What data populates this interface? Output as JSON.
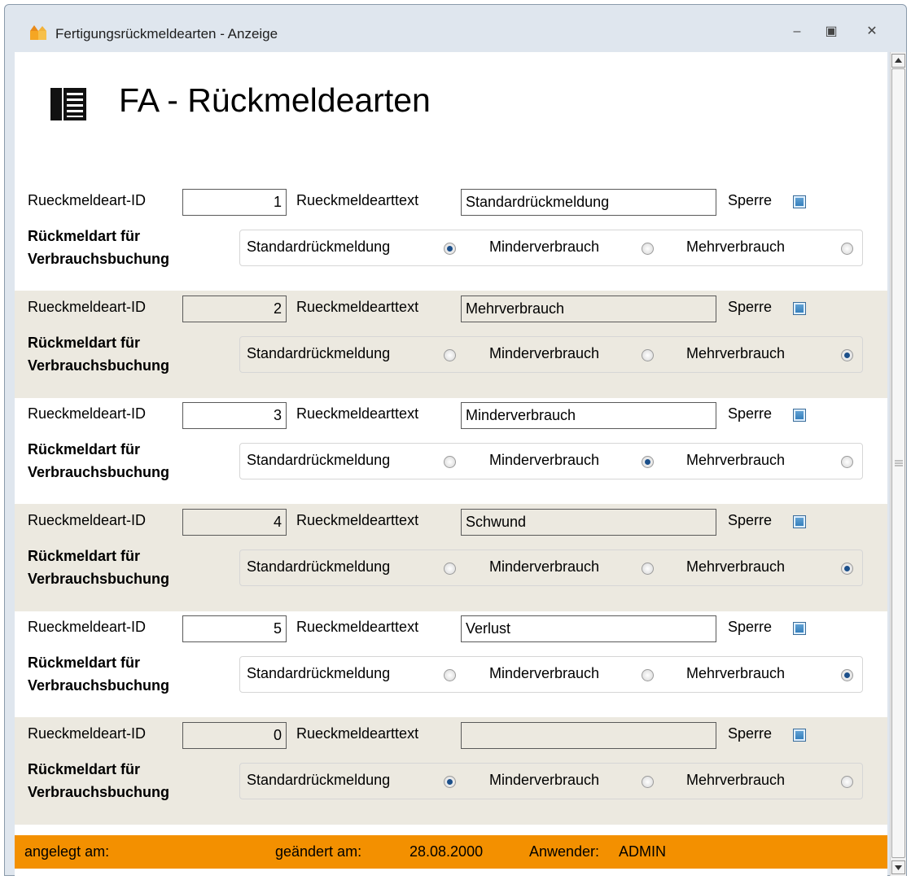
{
  "window": {
    "title": "Fertigungsrückmeldearten - Anzeige"
  },
  "page": {
    "title": "FA - Rückmeldearten"
  },
  "labels": {
    "id": "Rueckmeldeart-ID",
    "text": "Rueckmeldearttext",
    "lock": "Sperre",
    "usage_line1": "Rückmeldart für",
    "usage_line2": "Verbrauchsbuchung",
    "opt_standard": "Standardrückmeldung",
    "opt_minder": "Minderverbrauch",
    "opt_mehr": "Mehrverbrauch"
  },
  "records": [
    {
      "id": "1",
      "text": "Standardrückmeldung",
      "selected": "standard"
    },
    {
      "id": "2",
      "text": "Mehrverbrauch",
      "selected": "mehr"
    },
    {
      "id": "3",
      "text": "Minderverbrauch",
      "selected": "minder"
    },
    {
      "id": "4",
      "text": "Schwund",
      "selected": "mehr"
    },
    {
      "id": "5",
      "text": "Verlust",
      "selected": "mehr"
    },
    {
      "id": "0",
      "text": "",
      "selected": "standard"
    }
  ],
  "footer": {
    "created_label": "angelegt am:",
    "changed_label": "geändert am:",
    "changed_value": "28.08.2000",
    "user_label": "Anwender:",
    "user_value": "ADMIN"
  },
  "colors": {
    "footer": "#f39000",
    "alt_row": "#ece9e0",
    "radio_selected": "#1b4f8a"
  }
}
